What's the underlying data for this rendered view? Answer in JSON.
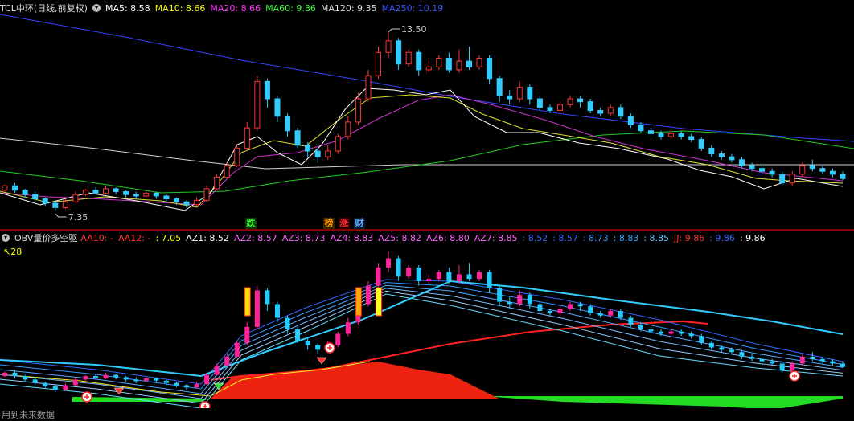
{
  "main_panel": {
    "ticker": "TCL中环(日线,前复权)",
    "indicators": [
      {
        "label": "MA5: 8.58",
        "color": "#ffffff"
      },
      {
        "label": "MA10: 8.66",
        "color": "#ffff00"
      },
      {
        "label": "MA20: 8.66",
        "color": "#ff33ff"
      },
      {
        "label": "MA60: 9.86",
        "color": "#33ff33"
      },
      {
        "label": "MA120: 9.35",
        "color": "#dcdcdc"
      },
      {
        "label": "MA250: 10.19",
        "color": "#3355ff"
      }
    ],
    "high_label": "13.50",
    "low_label": "7.35",
    "events": [
      {
        "text": "跌",
        "color": "#33ff33",
        "bg": "#113311"
      },
      {
        "text": "榜",
        "color": "#ff9900",
        "bg": "#332200"
      },
      {
        "text": "涨",
        "color": "#ff3333",
        "bg": "#330000"
      },
      {
        "text": "财",
        "color": "#66aaff",
        "bg": "#001a33"
      }
    ]
  },
  "sub_panel": {
    "title": "OBV量价多空驱",
    "indicators": [
      {
        "label": "AA10: -",
        "color": "#ff3333"
      },
      {
        "label": "AA12: -",
        "color": "#ff3333"
      },
      {
        "label": ": 7.05",
        "color": "#ffff00"
      },
      {
        "label": "AZ1: 8.52",
        "color": "#ffffff"
      },
      {
        "label": "AZ2: 8.57",
        "color": "#ff66ff"
      },
      {
        "label": "AZ3: 8.73",
        "color": "#ff66ff"
      },
      {
        "label": "AZ4: 8.83",
        "color": "#ff66ff"
      },
      {
        "label": "AZ5: 8.82",
        "color": "#ff66ff"
      },
      {
        "label": "AZ6: 8.80",
        "color": "#ff66ff"
      },
      {
        "label": "AZ7: 8.85",
        "color": "#ff66ff"
      },
      {
        "label": ": 8.52",
        "color": "#3366ff"
      },
      {
        "label": ": 8.57",
        "color": "#3366ff"
      },
      {
        "label": ": 8.73",
        "color": "#3399ff"
      },
      {
        "label": ": 8.83",
        "color": "#33aaff"
      },
      {
        "label": ": 8.85",
        "color": "#66ccff"
      },
      {
        "label": "JJ: 9.86",
        "color": "#ff3333"
      },
      {
        "label": ": 9.86",
        "color": "#3366ff"
      },
      {
        "label": ": 9.86",
        "color": "#ffffff"
      }
    ],
    "marker": "28"
  },
  "footer": {
    "text": "用到未来数据"
  },
  "colors": {
    "up": "#ff3333",
    "down": "#33ccff",
    "ma250": "#3344ff",
    "ma120": "#d0d0d0",
    "ma60": "#22cc22",
    "ma20": "#cc33cc",
    "ma10": "#dddd33",
    "ma5": "#ffffff"
  },
  "chart_data": {
    "type": "candlestick",
    "price_range": [
      7.0,
      14.0
    ],
    "candles": [
      [
        8.05,
        8.2,
        8.0,
        8.25
      ],
      [
        8.2,
        8.05,
        7.95,
        8.3
      ],
      [
        8.05,
        7.9,
        7.8,
        8.1
      ],
      [
        7.9,
        7.75,
        7.65,
        8.0
      ],
      [
        7.75,
        7.6,
        7.5,
        7.8
      ],
      [
        7.6,
        7.45,
        7.35,
        7.7
      ],
      [
        7.45,
        7.65,
        7.4,
        7.75
      ],
      [
        7.65,
        7.9,
        7.6,
        8.0
      ],
      [
        7.9,
        8.05,
        7.85,
        8.1
      ],
      [
        8.05,
        7.95,
        7.9,
        8.15
      ],
      [
        7.95,
        8.1,
        7.9,
        8.2
      ],
      [
        8.1,
        8.0,
        7.9,
        8.15
      ],
      [
        8.0,
        7.9,
        7.8,
        8.05
      ],
      [
        7.9,
        7.85,
        7.75,
        8.0
      ],
      [
        7.85,
        7.95,
        7.8,
        8.0
      ],
      [
        7.95,
        7.85,
        7.75,
        8.0
      ],
      [
        7.85,
        7.75,
        7.65,
        7.9
      ],
      [
        7.75,
        7.65,
        7.55,
        7.8
      ],
      [
        7.65,
        7.55,
        7.45,
        7.7
      ],
      [
        7.55,
        7.7,
        7.5,
        7.8
      ],
      [
        7.7,
        8.1,
        7.65,
        8.2
      ],
      [
        8.1,
        8.5,
        8.05,
        8.6
      ],
      [
        8.5,
        8.9,
        8.45,
        9.0
      ],
      [
        8.9,
        9.5,
        8.85,
        9.6
      ],
      [
        9.5,
        10.2,
        9.4,
        10.4
      ],
      [
        10.2,
        11.8,
        10.1,
        12.0
      ],
      [
        11.8,
        11.2,
        10.9,
        11.9
      ],
      [
        11.2,
        10.6,
        10.4,
        11.3
      ],
      [
        10.6,
        10.1,
        9.9,
        10.7
      ],
      [
        10.1,
        9.6,
        9.5,
        10.2
      ],
      [
        9.6,
        9.4,
        9.2,
        9.7
      ],
      [
        9.4,
        9.2,
        9.0,
        9.5
      ],
      [
        9.2,
        9.4,
        9.1,
        9.6
      ],
      [
        9.4,
        9.9,
        9.3,
        10.0
      ],
      [
        9.9,
        10.4,
        9.8,
        10.6
      ],
      [
        10.4,
        11.2,
        10.3,
        11.4
      ],
      [
        11.2,
        12.0,
        11.1,
        12.2
      ],
      [
        12.0,
        12.8,
        11.9,
        13.0
      ],
      [
        12.8,
        13.2,
        12.6,
        13.5
      ],
      [
        13.2,
        12.4,
        12.2,
        13.3
      ],
      [
        12.4,
        12.8,
        12.3,
        12.9
      ],
      [
        12.8,
        12.2,
        12.0,
        12.9
      ],
      [
        12.2,
        12.3,
        12.1,
        12.5
      ],
      [
        12.3,
        12.6,
        12.2,
        12.7
      ],
      [
        12.6,
        12.2,
        12.1,
        12.8
      ],
      [
        12.2,
        12.5,
        12.1,
        12.9
      ],
      [
        12.5,
        12.3,
        12.2,
        13.0
      ],
      [
        12.3,
        12.6,
        12.2,
        12.7
      ],
      [
        12.6,
        11.9,
        11.7,
        12.7
      ],
      [
        11.9,
        11.3,
        11.1,
        12.0
      ],
      [
        11.3,
        11.2,
        11.0,
        11.5
      ],
      [
        11.2,
        11.6,
        11.1,
        11.8
      ],
      [
        11.6,
        11.2,
        11.0,
        11.7
      ],
      [
        11.2,
        10.9,
        10.8,
        11.3
      ],
      [
        10.9,
        10.8,
        10.7,
        11.0
      ],
      [
        10.8,
        11.0,
        10.7,
        11.1
      ],
      [
        11.0,
        11.2,
        10.9,
        11.3
      ],
      [
        11.2,
        11.1,
        10.9,
        11.3
      ],
      [
        11.1,
        10.8,
        10.7,
        11.2
      ],
      [
        10.8,
        10.7,
        10.6,
        10.9
      ],
      [
        10.7,
        10.9,
        10.6,
        11.0
      ],
      [
        10.9,
        10.6,
        10.5,
        11.0
      ],
      [
        10.6,
        10.3,
        10.2,
        10.7
      ],
      [
        10.3,
        10.1,
        10.0,
        10.4
      ],
      [
        10.1,
        10.0,
        9.9,
        10.2
      ],
      [
        10.0,
        9.9,
        9.8,
        10.1
      ],
      [
        9.9,
        10.0,
        9.8,
        10.1
      ],
      [
        10.0,
        9.9,
        9.8,
        10.1
      ],
      [
        9.9,
        9.8,
        9.7,
        10.0
      ],
      [
        9.8,
        9.5,
        9.4,
        9.9
      ],
      [
        9.5,
        9.3,
        9.2,
        9.6
      ],
      [
        9.3,
        9.2,
        9.1,
        9.4
      ],
      [
        9.2,
        9.1,
        9.0,
        9.3
      ],
      [
        9.1,
        8.9,
        8.8,
        9.2
      ],
      [
        8.9,
        8.8,
        8.7,
        9.0
      ],
      [
        8.8,
        8.7,
        8.6,
        8.9
      ],
      [
        8.7,
        8.6,
        8.5,
        8.8
      ],
      [
        8.6,
        8.3,
        8.2,
        8.7
      ],
      [
        8.3,
        8.6,
        8.2,
        8.7
      ],
      [
        8.6,
        8.9,
        8.5,
        9.0
      ],
      [
        8.9,
        8.8,
        8.7,
        9.1
      ],
      [
        8.8,
        8.7,
        8.6,
        8.9
      ],
      [
        8.7,
        8.6,
        8.5,
        8.8
      ],
      [
        8.6,
        8.45,
        8.4,
        8.7
      ]
    ]
  }
}
